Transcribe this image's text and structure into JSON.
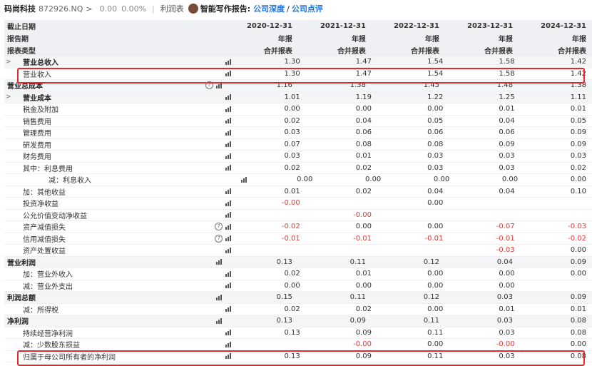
{
  "topbar": {
    "stock_name": "码尚科技",
    "code": "872926.NQ",
    "arrow": ">",
    "price": "0.00",
    "pct": "0.00%",
    "tab": "利润表",
    "ai_label": "智能写作报告:",
    "link1": "公司深度",
    "slash": "/",
    "link2": "公司点评"
  },
  "header_rows": [
    {
      "label": "截止日期",
      "values": [
        "2020-12-31",
        "2021-12-31",
        "2022-12-31",
        "2023-12-31",
        "2024-12-31"
      ]
    },
    {
      "label": "报告期",
      "values": [
        "年报",
        "年报",
        "年报",
        "年报",
        "年报"
      ]
    },
    {
      "label": "报表类型",
      "values": [
        "合并报表",
        "合并报表",
        "合并报表",
        "合并报表",
        "合并报表"
      ]
    }
  ],
  "rows": [
    {
      "label": "营业总收入",
      "indent": 1,
      "caret": true,
      "bold": true,
      "help": false,
      "values": [
        "1.30",
        "1.47",
        "1.54",
        "1.58",
        "1.42"
      ]
    },
    {
      "label": "营业收入",
      "indent": 1,
      "caret": false,
      "bold": false,
      "help": false,
      "values": [
        "1.30",
        "1.47",
        "1.54",
        "1.58",
        "1.42"
      ]
    },
    {
      "label": "营业总成本",
      "indent": 0,
      "caret": false,
      "bold": true,
      "help": true,
      "values": [
        "1.16",
        "1.38",
        "1.45",
        "1.48",
        "1.38"
      ]
    },
    {
      "label": "营业成本",
      "indent": 1,
      "caret": true,
      "bold": true,
      "help": false,
      "values": [
        "1.01",
        "1.19",
        "1.22",
        "1.25",
        "1.11"
      ]
    },
    {
      "label": "税金及附加",
      "indent": 1,
      "caret": false,
      "bold": false,
      "help": false,
      "values": [
        "0.00",
        "0.00",
        "0.00",
        "0.01",
        "0.01"
      ]
    },
    {
      "label": "销售费用",
      "indent": 1,
      "caret": false,
      "bold": false,
      "help": false,
      "values": [
        "0.02",
        "0.04",
        "0.05",
        "0.04",
        "0.05"
      ]
    },
    {
      "label": "管理费用",
      "indent": 1,
      "caret": false,
      "bold": false,
      "help": false,
      "values": [
        "0.03",
        "0.06",
        "0.06",
        "0.06",
        "0.09"
      ]
    },
    {
      "label": "研发费用",
      "indent": 1,
      "caret": false,
      "bold": false,
      "help": false,
      "values": [
        "0.07",
        "0.08",
        "0.08",
        "0.09",
        "0.09"
      ]
    },
    {
      "label": "财务费用",
      "indent": 1,
      "caret": false,
      "bold": false,
      "help": false,
      "values": [
        "0.03",
        "0.01",
        "0.03",
        "0.03",
        "0.03"
      ]
    },
    {
      "label": "其中：利息费用",
      "indent": 1,
      "caret": false,
      "bold": false,
      "help": false,
      "values": [
        "0.02",
        "0.02",
        "0.03",
        "0.03",
        "0.02"
      ]
    },
    {
      "label": "减：利息收入",
      "indent": 2,
      "caret": false,
      "bold": false,
      "help": false,
      "values": [
        "0.00",
        "0.00",
        "0.00",
        "0.00",
        "0.00"
      ]
    },
    {
      "label": "加：其他收益",
      "indent": 1,
      "caret": false,
      "bold": false,
      "help": false,
      "values": [
        "0.01",
        "0.02",
        "0.04",
        "0.04",
        "0.10"
      ]
    },
    {
      "label": "投资净收益",
      "indent": 1,
      "caret": false,
      "bold": false,
      "help": false,
      "values": [
        "-0.00",
        "",
        "0.00",
        "",
        ""
      ]
    },
    {
      "label": "公允价值变动净收益",
      "indent": 1,
      "caret": false,
      "bold": false,
      "help": false,
      "values": [
        "",
        "-0.00",
        "",
        "",
        ""
      ]
    },
    {
      "label": "资产减值损失",
      "indent": 1,
      "caret": false,
      "bold": false,
      "help": true,
      "values": [
        "-0.02",
        "0.00",
        "0.00",
        "-0.07",
        "-0.03"
      ]
    },
    {
      "label": "信用减值损失",
      "indent": 1,
      "caret": false,
      "bold": false,
      "help": true,
      "values": [
        "-0.01",
        "-0.01",
        "-0.01",
        "-0.01",
        "-0.02"
      ]
    },
    {
      "label": "资产处置收益",
      "indent": 1,
      "caret": false,
      "bold": false,
      "help": false,
      "values": [
        "",
        "",
        "",
        "-0.03",
        "0.00"
      ]
    },
    {
      "label": "营业利润",
      "indent": 0,
      "caret": false,
      "bold": true,
      "help": false,
      "values": [
        "0.13",
        "0.11",
        "0.12",
        "0.04",
        "0.09"
      ]
    },
    {
      "label": "加：营业外收入",
      "indent": 1,
      "caret": false,
      "bold": false,
      "help": false,
      "values": [
        "0.02",
        "0.01",
        "0.00",
        "0.00",
        "0.00"
      ]
    },
    {
      "label": "减：营业外支出",
      "indent": 1,
      "caret": false,
      "bold": false,
      "help": false,
      "values": [
        "0.00",
        "0.00",
        "0.00",
        "0.00",
        ""
      ]
    },
    {
      "label": "利润总额",
      "indent": 0,
      "caret": false,
      "bold": true,
      "help": false,
      "values": [
        "0.15",
        "0.11",
        "0.12",
        "0.03",
        "0.09"
      ]
    },
    {
      "label": "减：所得税",
      "indent": 1,
      "caret": false,
      "bold": false,
      "help": false,
      "values": [
        "0.02",
        "0.02",
        "0.00",
        "0.01",
        "0.01"
      ]
    },
    {
      "label": "净利润",
      "indent": 0,
      "caret": false,
      "bold": true,
      "help": false,
      "values": [
        "0.13",
        "0.09",
        "0.11",
        "0.03",
        "0.08"
      ]
    },
    {
      "label": "持续经营净利润",
      "indent": 1,
      "caret": false,
      "bold": false,
      "help": false,
      "values": [
        "0.13",
        "0.09",
        "0.11",
        "0.03",
        "0.08"
      ]
    },
    {
      "label": "减：少数股东损益",
      "indent": 1,
      "caret": false,
      "bold": false,
      "help": false,
      "values": [
        "",
        "-0.00",
        "0.00",
        "-0.00",
        "0.00"
      ]
    },
    {
      "label": "归属于母公司所有者的净利润",
      "indent": 1,
      "caret": false,
      "bold": false,
      "help": false,
      "values": [
        "0.13",
        "0.09",
        "0.11",
        "0.03",
        "0.08"
      ]
    }
  ],
  "colors": {
    "negative": "#e53935",
    "highlight_box": "#e8272a",
    "link": "#1a73e8"
  },
  "icons": {
    "chart": "bar-chart-icon",
    "help": "question-circle-icon",
    "expand": "caret-right-icon"
  }
}
